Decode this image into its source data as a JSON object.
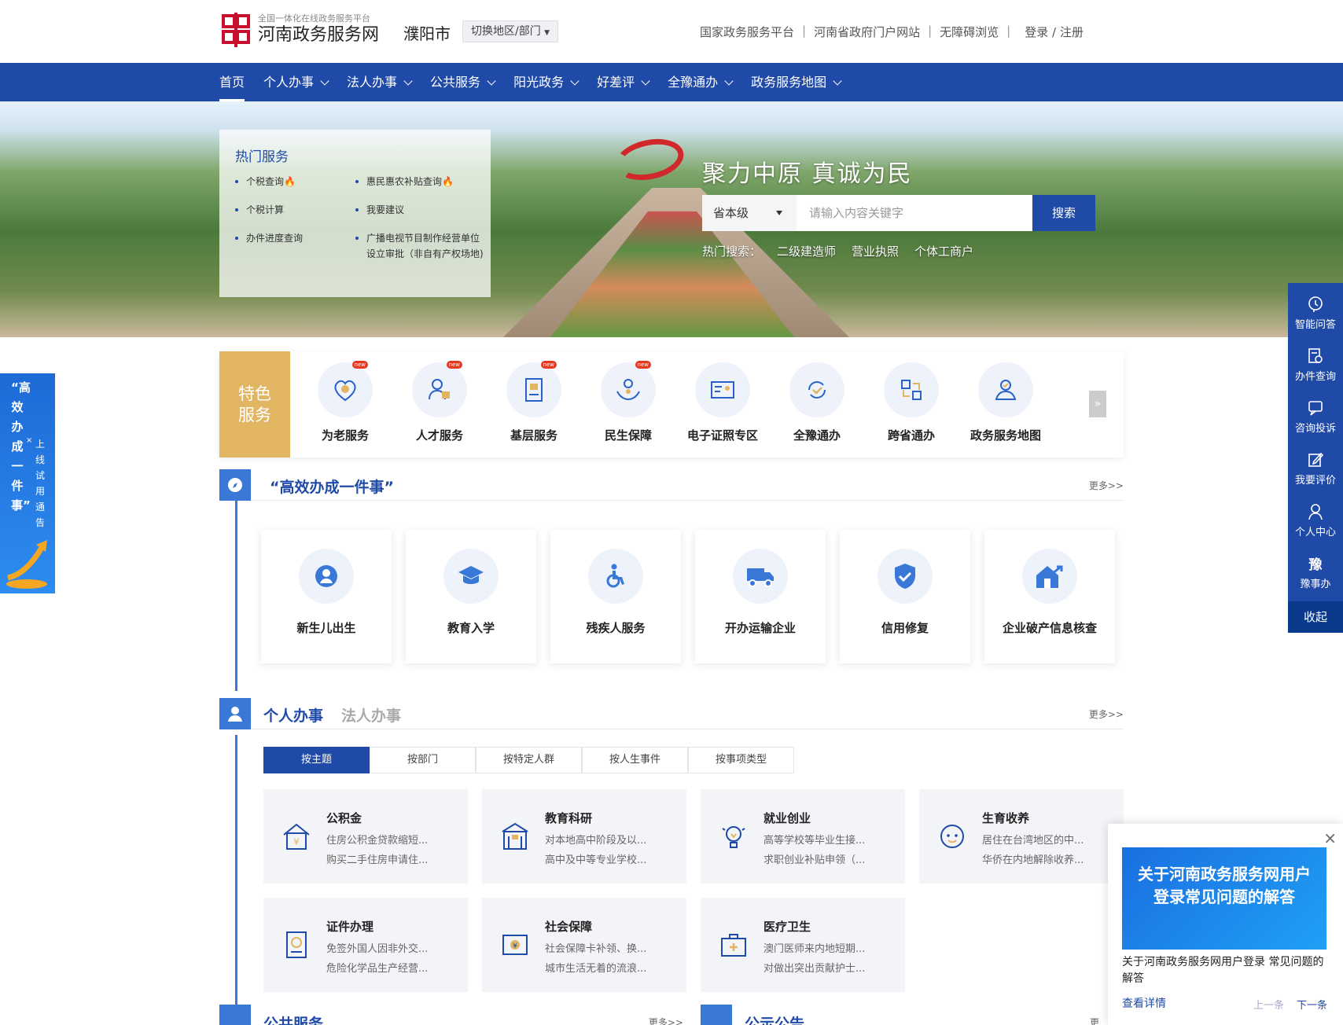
{
  "header": {
    "logo_sub": "全国一体化在线政务服务平台",
    "logo_main": "河南政务服务网",
    "city": "濮阳市",
    "switch_label": "切换地区/部门",
    "links": [
      "国家政务服务平台",
      "河南省政府门户网站",
      "无障碍浏览"
    ],
    "login": "登录 / 注册"
  },
  "nav": {
    "items": [
      "首页",
      "个人办事",
      "法人办事",
      "公共服务",
      "阳光政务",
      "好差评",
      "全豫通办",
      "政务服务地图"
    ]
  },
  "hot_services": {
    "title": "热门服务",
    "items": [
      "个税查询",
      "惠民惠农补贴查询",
      "个税计算",
      "我要建议",
      "办件进度查询",
      "广播电视节目制作经营单位设立审批（非自有产权场地)"
    ]
  },
  "hero": {
    "slogan": "聚力中原  真诚为民",
    "search_level": "省本级",
    "search_placeholder": "请输入内容关键字",
    "search_button": "搜索",
    "hot_search_label": "热门搜索：",
    "hot_search_terms": [
      "二级建造师",
      "营业执照",
      "个体工商户"
    ]
  },
  "featured": {
    "label": "特色服务",
    "badge": "new",
    "items": [
      "为老服务",
      "人才服务",
      "基层服务",
      "民生保障",
      "电子证照专区",
      "全豫通办",
      "跨省通办",
      "政务服务地图"
    ]
  },
  "efficient": {
    "title": "“高效办成一件事”",
    "more": "更多>>",
    "items": [
      "新生儿出生",
      "教育入学",
      "残疾人服务",
      "开办运输企业",
      "信用修复",
      "企业破产信息核查"
    ]
  },
  "personal": {
    "title": "个人办事",
    "title_alt": "法人办事",
    "more": "更多>>",
    "tabs": [
      "按主题",
      "按部门",
      "按特定人群",
      "按人生事件",
      "按事项类型"
    ],
    "topics": [
      {
        "title": "公积金",
        "l1": "住房公积金贷款缩短...",
        "l2": "购买二手住房申请住..."
      },
      {
        "title": "教育科研",
        "l1": "对本地高中阶段及以...",
        "l2": "高中及中等专业学校..."
      },
      {
        "title": "就业创业",
        "l1": "高等学校等毕业生接...",
        "l2": "求职创业补贴申领（..."
      },
      {
        "title": "生育收养",
        "l1": "居住在台湾地区的中...",
        "l2": "华侨在内地解除收养..."
      },
      {
        "title": "证件办理",
        "l1": "免签外国人因非外交...",
        "l2": "危险化学品生产经营..."
      },
      {
        "title": "社会保障",
        "l1": "社会保障卡补领、换...",
        "l2": "城市生活无着的流浪..."
      },
      {
        "title": "医疗卫生",
        "l1": "澳门医师来内地短期...",
        "l2": "对做出突出贡献护士..."
      }
    ]
  },
  "bottom": {
    "public_service": "公共服务",
    "public_more": "更多>>",
    "notice": "公示公告",
    "notice_more": "更多"
  },
  "float_bar": {
    "items": [
      "智能问答",
      "办件查询",
      "咨询投诉",
      "我要评价",
      "个人中心",
      "豫事办"
    ],
    "close": "收起"
  },
  "left_banner": {
    "main": "“高效办成一件事”",
    "sub": "上线试用通告"
  },
  "popup": {
    "image_text": "关于河南政务服务网用户登录常见问题的解答",
    "text": "关于河南政务服务网用户登录 常见问题的解答",
    "link": "查看详情",
    "prev": "上一条",
    "next": "下一条"
  },
  "colors": {
    "primary": "#1f4aa8",
    "accent_blue": "#3a78d8",
    "featured_gold": "#e2b563",
    "hot_fire": "#e5381f"
  }
}
